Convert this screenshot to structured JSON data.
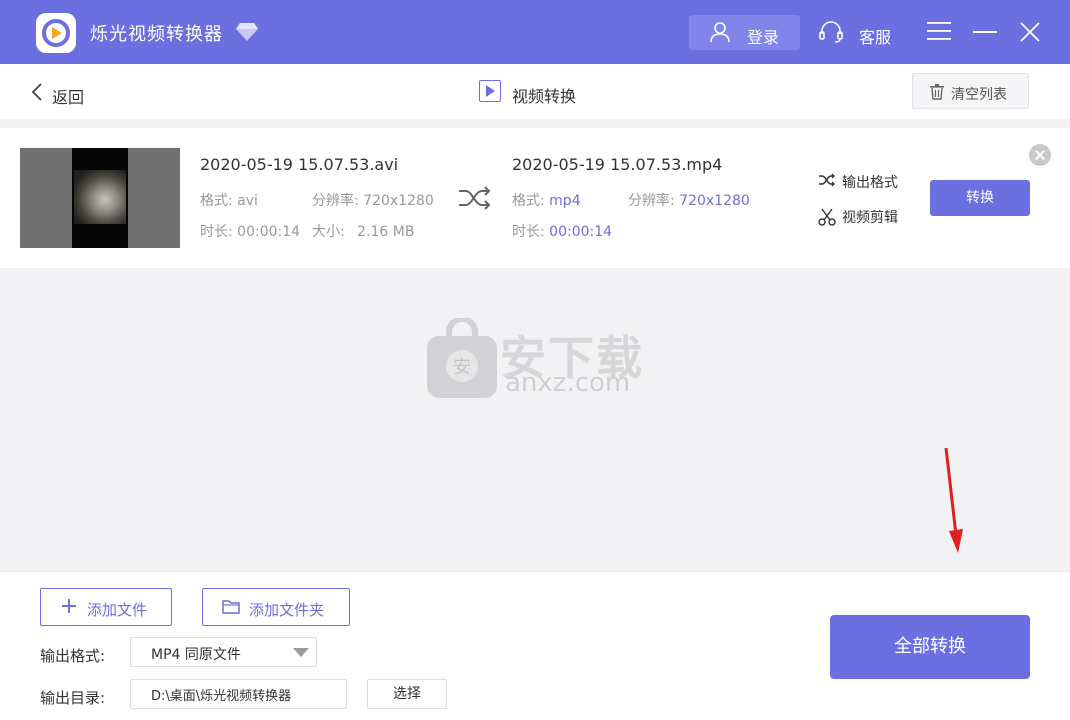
{
  "titlebar": {
    "app_title": "烁光视频转换器",
    "login_label": "登录",
    "service_label": "客服",
    "accent_color": "#6b6fe0"
  },
  "subheader": {
    "back_label": "返回",
    "page_title": "视频转换",
    "clear_label": "清空列表"
  },
  "file": {
    "source": {
      "name": "2020-05-19 15.07.53.avi",
      "format_label": "格式:",
      "format": "avi",
      "resolution_label": "分辨率:",
      "resolution": "720x1280",
      "duration_label": "时长:",
      "duration": "00:00:14",
      "size_label": "大小:",
      "size": "2.16 MB"
    },
    "output": {
      "name": "2020-05-19 15.07.53.mp4",
      "format_label": "格式:",
      "format": "mp4",
      "resolution_label": "分辨率:",
      "resolution": "720x1280",
      "duration_label": "时长:",
      "duration": "00:00:14"
    },
    "output_format_link": "输出格式",
    "video_edit_link": "视频剪辑",
    "convert_label": "转换"
  },
  "watermark": {
    "text": "安下载",
    "sub": "anxz.com",
    "badge": "安"
  },
  "bottom": {
    "add_file_label": "添加文件",
    "add_folder_label": "添加文件夹",
    "output_format_label": "输出格式:",
    "output_format_value": "MP4 同原文件",
    "output_dir_label": "输出目录:",
    "output_dir_value": "D:\\桌面\\烁光视频转换器",
    "choose_label": "选择",
    "convert_all_label": "全部转换"
  },
  "icons": {
    "app_logo": "play-logo-icon",
    "vip": "diamond-icon",
    "user": "user-icon",
    "service": "headset-icon",
    "menu": "menu-icon",
    "minimize": "minimize-icon",
    "close": "close-icon",
    "back": "chevron-left-icon",
    "trash": "trash-icon",
    "swap": "shuffle-icon",
    "scissors": "scissors-icon"
  }
}
